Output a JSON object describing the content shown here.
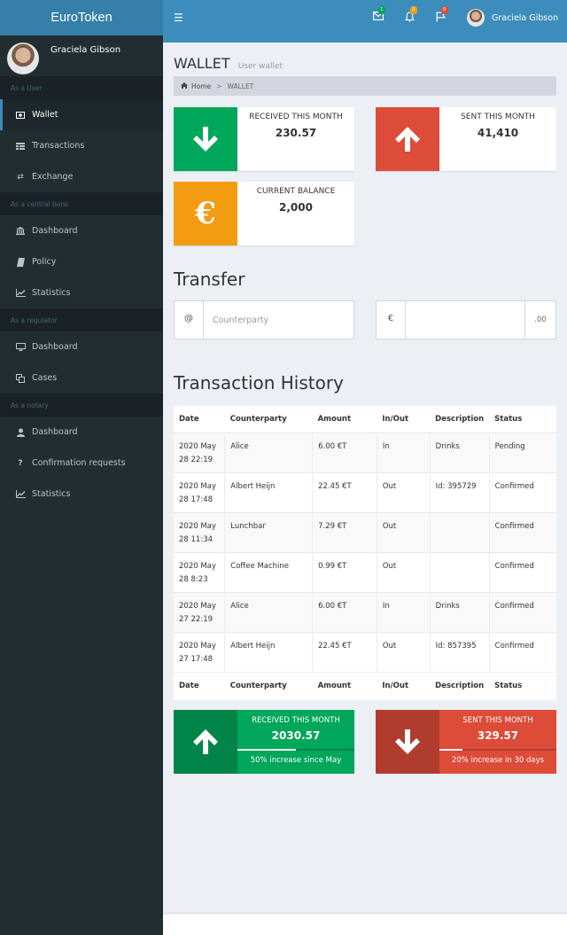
{
  "app": {
    "title": "EuroToken"
  },
  "user": {
    "name": "Graciela Gibson"
  },
  "sidebar": {
    "sections": [
      {
        "header": "As a User",
        "items": [
          {
            "label": "Wallet",
            "icon": "money-icon",
            "active": true
          },
          {
            "label": "Transactions",
            "icon": "table-icon"
          },
          {
            "label": "Exchange",
            "icon": "exchange-icon"
          }
        ]
      },
      {
        "header": "As a central bank",
        "items": [
          {
            "label": "Dashboard",
            "icon": "bank-icon"
          },
          {
            "label": "Policy",
            "icon": "book-icon"
          },
          {
            "label": "Statistics",
            "icon": "line-chart-icon"
          }
        ]
      },
      {
        "header": "As a regulator",
        "items": [
          {
            "label": "Dashboard",
            "icon": "desktop-icon"
          },
          {
            "label": "Cases",
            "icon": "copy-icon"
          }
        ]
      },
      {
        "header": "As a notary",
        "items": [
          {
            "label": "Dashboard",
            "icon": "user-icon"
          },
          {
            "label": "Confirmation requests",
            "icon": "question-icon"
          },
          {
            "label": "Statistics",
            "icon": "line-chart-icon"
          }
        ]
      }
    ]
  },
  "navbar": {
    "messages_count": "1",
    "notifications_count": "3",
    "flags_count": "0",
    "colors": {
      "messages": "#00a65a",
      "notifications": "#f39c12",
      "flags": "#dd4b39"
    }
  },
  "page": {
    "title": "WALLET",
    "subtitle": "User wallet"
  },
  "breadcrumb": {
    "home": "Home",
    "current": "WALLET"
  },
  "info_boxes": {
    "received": {
      "label": "RECEIVED THIS MONTH",
      "value": "230.57",
      "color": "#00a65a",
      "icon": "arrow-down-icon"
    },
    "sent": {
      "label": "SENT THIS MONTH",
      "value": "41,410",
      "color": "#dd4b39",
      "icon": "arrow-up-icon"
    },
    "balance": {
      "label": "CURRENT BALANCE",
      "value": "2,000",
      "color": "#f39c12",
      "icon": "euro-icon",
      "symbol": "€"
    }
  },
  "transfer": {
    "title": "Transfer",
    "counterparty_prefix": "@",
    "counterparty_placeholder": "Counterparty",
    "amount_prefix": "€",
    "amount_suffix": ".00",
    "amount_value": ""
  },
  "history": {
    "title": "Transaction History",
    "columns": [
      "Date",
      "Counterparty",
      "Amount",
      "In/Out",
      "Description",
      "Status"
    ],
    "rows": [
      {
        "date": "2020 May 28 22:19",
        "counterparty": "Alice",
        "amount": "6.00 €T",
        "inout": "In",
        "description": "Drinks",
        "status": "Pending"
      },
      {
        "date": "2020 May 28 17:48",
        "counterparty": "Albert Heijn",
        "amount": "22.45 €T",
        "inout": "Out",
        "description": "Id: 395729",
        "status": "Confirmed"
      },
      {
        "date": "2020 May 28 11:34",
        "counterparty": "Lunchbar",
        "amount": "7.29 €T",
        "inout": "Out",
        "description": "",
        "status": "Confirmed"
      },
      {
        "date": "2020 May 28 8:23",
        "counterparty": "Coffee Machine",
        "amount": "0.99 €T",
        "inout": "Out",
        "description": "",
        "status": "Confirmed"
      },
      {
        "date": "2020 May 27 22:19",
        "counterparty": "Alice",
        "amount": "6.00 €T",
        "inout": "In",
        "description": "Drinks",
        "status": "Confirmed"
      },
      {
        "date": "2020 May 27 17:48",
        "counterparty": "Albert Heijn",
        "amount": "22.45 €T",
        "inout": "Out",
        "description": "Id: 857395",
        "status": "Confirmed"
      }
    ]
  },
  "stats": {
    "received": {
      "label": "RECEIVED THIS MONTH",
      "value": "2030.57",
      "progress": 0.5,
      "description": "50% increase since May",
      "color": "#00a65a",
      "icon": "arrow-up-icon"
    },
    "sent": {
      "label": "SENT THIS MONTH",
      "value": "329.57",
      "progress": 0.2,
      "description": "20% increase in 30 days",
      "color": "#dd4b39",
      "icon": "arrow-down-icon"
    }
  }
}
